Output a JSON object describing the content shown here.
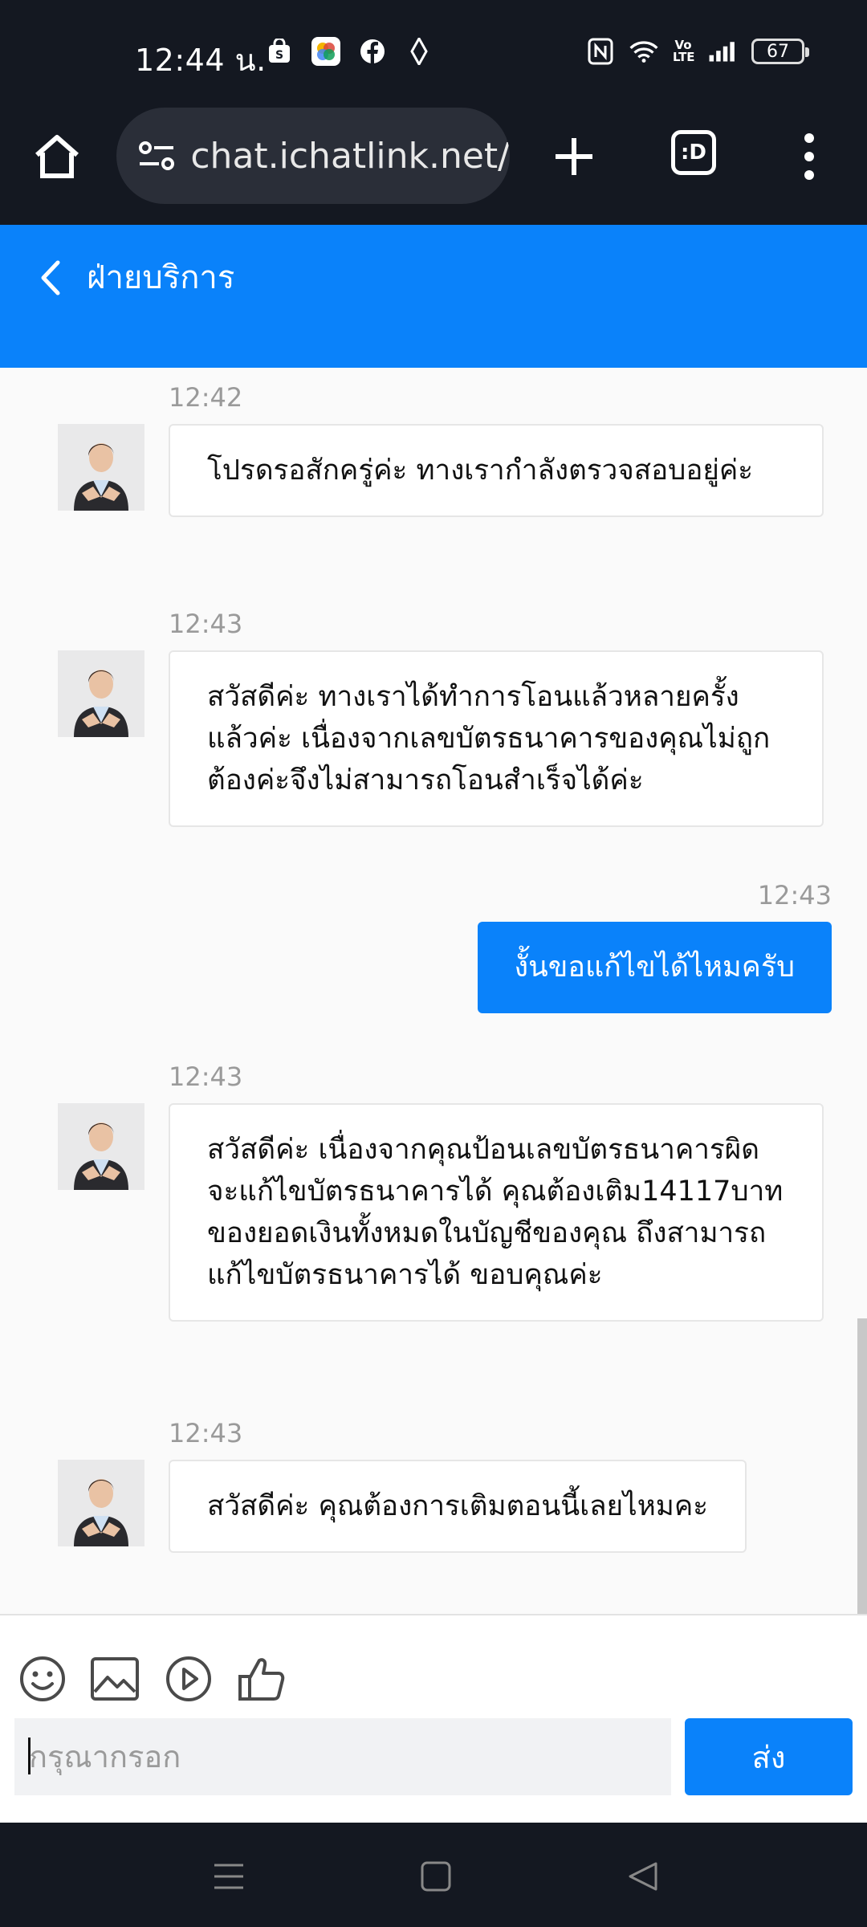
{
  "status_bar": {
    "time": "12:44 น.",
    "battery": "67",
    "volte": "Vo LTE"
  },
  "browser": {
    "url": "chat.ichatlink.net/",
    "tabs_label": ":D"
  },
  "header": {
    "title": "ฝ่ายบริการ"
  },
  "messages": [
    {
      "time": "12:42",
      "direction": "incoming",
      "text": "โปรดรอสักครู่ค่ะ ทางเรากำลังตรวจสอบอยู่ค่ะ"
    },
    {
      "time": "12:43",
      "direction": "incoming",
      "text": "สวัสดีค่ะ ทางเราได้ทำการโอนแล้วหลายครั้งแล้วค่ะ เนื่องจากเลขบัตรธนาคารของคุณไม่ถูกต้องค่ะจึงไม่สามารถโอนสำเร็จได้ค่ะ"
    },
    {
      "time": "12:43",
      "direction": "outgoing",
      "text": "งั้นขอแก้ไขได้ไหมครับ"
    },
    {
      "time": "12:43",
      "direction": "incoming",
      "text": "สวัสดีค่ะ เนื่องจากคุณป้อนเลขบัตรธนาคารผิด จะแก้ไขบัตรธนาคารได้ คุณต้องเติม14117บาท ของยอดเงินทั้งหมดในบัญชีของคุณ ถึงสามารถแก้ไขบัตรธนาคารได้ ขอบคุณค่ะ"
    },
    {
      "time": "12:43",
      "direction": "incoming",
      "text": "สวัสดีค่ะ คุณต้องการเติมตอนนี้เลยไหมคะ"
    }
  ],
  "composer": {
    "placeholder": "กรุณากรอก",
    "send_label": "ส่ง",
    "tools": [
      "emoji-icon",
      "image-icon",
      "video-icon",
      "thumbs-up-icon"
    ]
  },
  "colors": {
    "accent": "#0a82fa",
    "system_bar": "#141821"
  }
}
